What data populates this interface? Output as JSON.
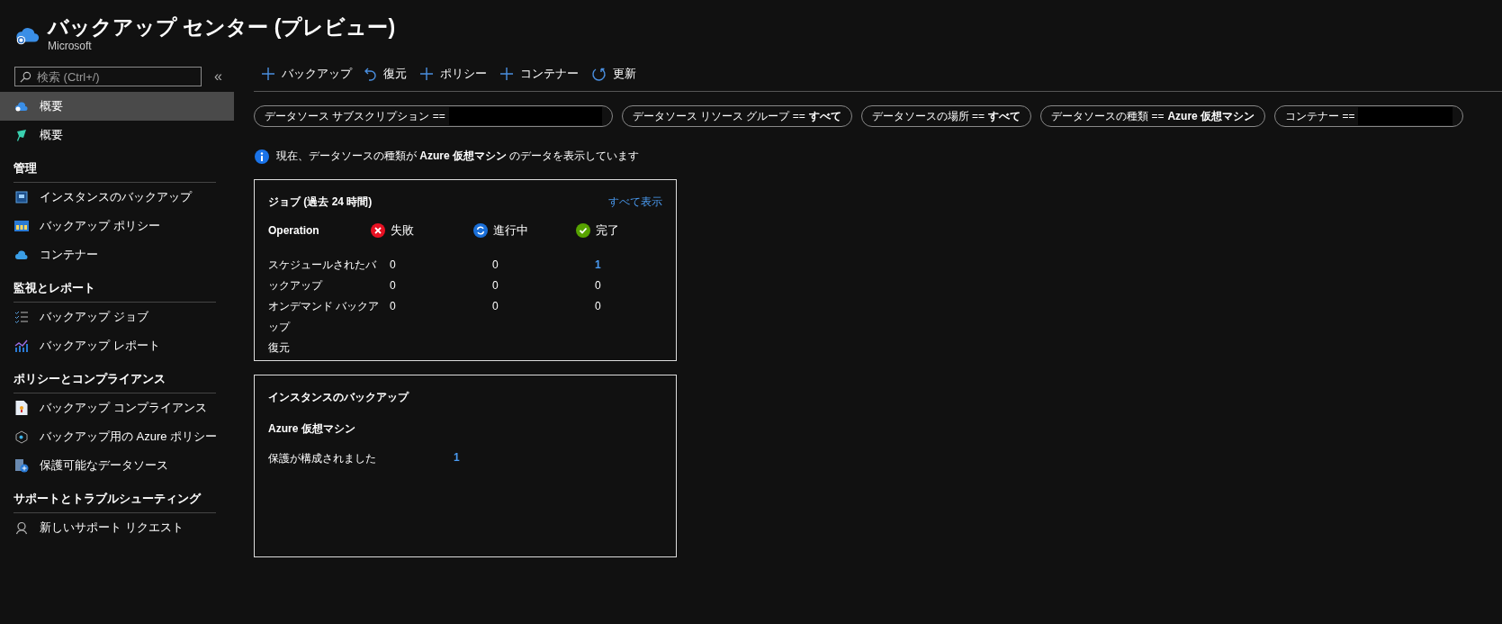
{
  "header": {
    "title": "バックアップ センター (プレビュー)",
    "subtitle": "Microsoft"
  },
  "sidebar": {
    "search": {
      "placeholder": "検索 (Ctrl+/)"
    },
    "collapse": "«",
    "items": [
      {
        "label": "概要",
        "selected": true
      },
      {
        "label": "概要",
        "selected": false
      }
    ],
    "sections": [
      {
        "title": "管理",
        "items": [
          {
            "label": "インスタンスのバックアップ",
            "selected": false
          },
          {
            "label": "バックアップ ポリシー",
            "selected": false
          },
          {
            "label": "コンテナー",
            "selected": false
          }
        ]
      },
      {
        "title": "監視とレポート",
        "items": [
          {
            "label": "バックアップ ジョブ",
            "selected": false
          },
          {
            "label": "バックアップ レポート",
            "selected": false
          }
        ]
      },
      {
        "title": "ポリシーとコンプライアンス",
        "items": [
          {
            "label": "バックアップ コンプライアンス",
            "selected": false
          },
          {
            "label": "バックアップ用の Azure ポリシー",
            "selected": false
          },
          {
            "label": "保護可能なデータソース",
            "selected": false
          }
        ]
      },
      {
        "title": "サポートとトラブルシューティング",
        "items": [
          {
            "label": "新しいサポート リクエスト",
            "selected": false
          }
        ]
      }
    ]
  },
  "toolbar": [
    {
      "label": "バックアップ",
      "kind": "add"
    },
    {
      "label": "復元",
      "kind": "undo"
    },
    {
      "label": "ポリシー",
      "kind": "add"
    },
    {
      "label": "コンテナー",
      "kind": "add"
    },
    {
      "label": "更新",
      "kind": "refresh"
    }
  ],
  "filters": [
    {
      "label": "データソース サブスクリプション ==",
      "redacted": true
    },
    {
      "label": "データソース リソース グループ ==",
      "value": "すべて",
      "redacted": false
    },
    {
      "label": "データソースの場所 ==",
      "value": "すべて",
      "redacted": false
    },
    {
      "label": "データソースの種類 ==",
      "value": "Azure 仮想マシン",
      "redacted": false
    },
    {
      "label": "コンテナー ==",
      "redacted": true
    }
  ],
  "info": "現在、データソースの種類が **Azure 仮想マシン** のデータを表示しています",
  "jobs": {
    "title": "ジョブ (過去 24 時間)",
    "view_all": "すべて表示",
    "operation": "Operation",
    "columns": [
      {
        "label": "失敗",
        "kind": "failed"
      },
      {
        "label": "進行中",
        "kind": "running"
      },
      {
        "label": "完了",
        "kind": "done"
      }
    ],
    "rows": [
      {
        "label": "スケジュールされたバックアップ",
        "values": [
          {
            "text": "0",
            "link": false
          },
          {
            "text": "0",
            "link": false
          },
          {
            "text": "1",
            "link": true
          }
        ]
      },
      {
        "label": "オンデマンド バックアップ",
        "values": [
          {
            "text": "0",
            "link": false
          },
          {
            "text": "0",
            "link": false
          },
          {
            "text": "0",
            "link": false
          }
        ]
      },
      {
        "label": "復元",
        "values": [
          {
            "text": "0",
            "link": false
          },
          {
            "text": "0",
            "link": false
          },
          {
            "text": "0",
            "link": false
          }
        ]
      }
    ]
  },
  "instances": {
    "title": "インスタンスのバックアップ",
    "subtitle": "Azure 仮想マシン",
    "rows": [
      {
        "label": "保護が構成されました",
        "value": "1"
      }
    ]
  }
}
